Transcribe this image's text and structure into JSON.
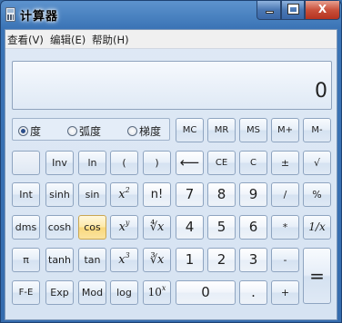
{
  "window": {
    "title": "计算器",
    "minimize": "_",
    "maximize": "□",
    "close": "X"
  },
  "menu": [
    "查看(V)",
    "编辑(E)",
    "帮助(H)"
  ],
  "display": {
    "value": "0"
  },
  "angle_units": {
    "options": [
      "度",
      "弧度",
      "梯度"
    ],
    "selected": "度"
  },
  "buttons": {
    "mc": "MC",
    "mr": "MR",
    "ms": "MS",
    "mplus": "M+",
    "mminus": "M-",
    "inv": "Inv",
    "ln": "ln",
    "lparen": "(",
    "rparen": ")",
    "backspace": "⟵",
    "ce": "CE",
    "c": "C",
    "plusminus": "±",
    "sqrt": "√",
    "int": "Int",
    "sinh": "sinh",
    "sin": "sin",
    "x2": "2",
    "nfact": "n!",
    "n7": "7",
    "n8": "8",
    "n9": "9",
    "div": "/",
    "pct": "%",
    "dms": "dms",
    "cosh": "cosh",
    "cos": "cos",
    "xy": "y",
    "yroot": "∜x",
    "n4": "4",
    "n5": "5",
    "n6": "6",
    "mul": "*",
    "recip": "1/x",
    "pi": "π",
    "tanh": "tanh",
    "tan": "tan",
    "x3": "3",
    "cuberoot": "∛x",
    "n1": "1",
    "n2": "2",
    "n3": "3",
    "sub": "-",
    "eq": "=",
    "fe": "F-E",
    "exp": "Exp",
    "mod": "Mod",
    "log": "log",
    "tenx": "x",
    "n0": "0",
    "dot": ".",
    "add": "+"
  }
}
